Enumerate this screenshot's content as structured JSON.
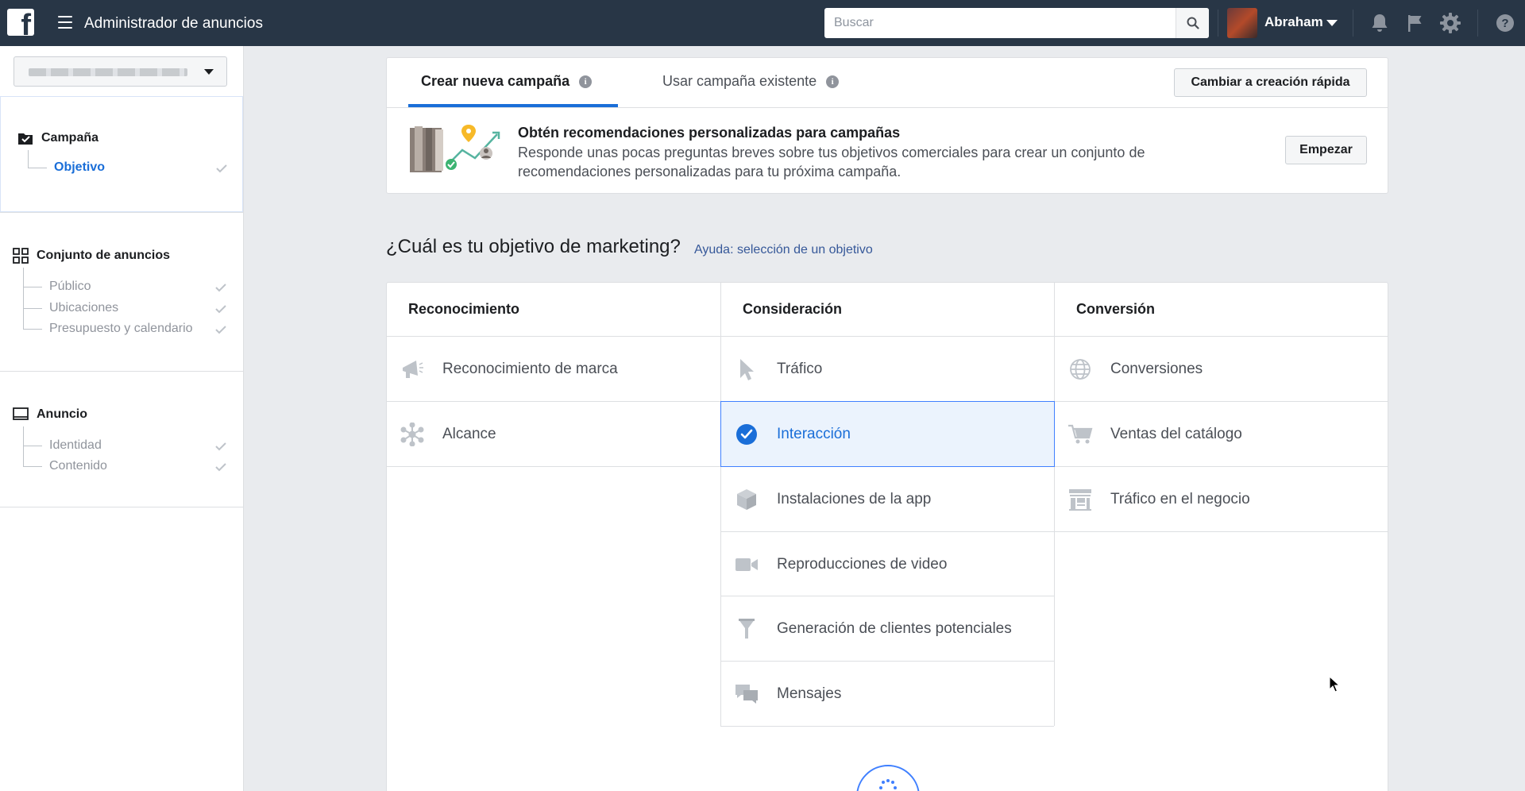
{
  "topbar": {
    "app_title": "Administrador de anuncios",
    "search_placeholder": "Buscar",
    "user_name": "Abraham"
  },
  "sidebar": {
    "sections": [
      {
        "title": "Campaña",
        "items": [
          {
            "label": "Objetivo",
            "active": true
          }
        ]
      },
      {
        "title": "Conjunto de anuncios",
        "items": [
          {
            "label": "Público"
          },
          {
            "label": "Ubicaciones"
          },
          {
            "label": "Presupuesto y calendario"
          }
        ]
      },
      {
        "title": "Anuncio",
        "items": [
          {
            "label": "Identidad"
          },
          {
            "label": "Contenido"
          }
        ]
      }
    ]
  },
  "tabs": {
    "create_new": "Crear nueva campaña",
    "use_existing": "Usar campaña existente",
    "switch_button": "Cambiar a creación rápida"
  },
  "recommendation": {
    "title": "Obtén recomendaciones personalizadas para campañas",
    "description": "Responde unas pocas preguntas breves sobre tus objetivos comerciales para crear un conjunto de recomendaciones personalizadas para tu próxima campaña.",
    "button": "Empezar"
  },
  "objectives": {
    "question": "¿Cuál es tu objetivo de marketing?",
    "help_link": "Ayuda: selección de un objetivo",
    "columns": [
      {
        "title": "Reconocimiento",
        "items": [
          "Reconocimiento de marca",
          "Alcance"
        ]
      },
      {
        "title": "Consideración",
        "items": [
          "Tráfico",
          "Interacción",
          "Instalaciones de la app",
          "Reproducciones de video",
          "Generación de clientes potenciales",
          "Mensajes"
        ]
      },
      {
        "title": "Conversión",
        "items": [
          "Conversiones",
          "Ventas del catálogo",
          "Tráfico en el negocio"
        ]
      }
    ],
    "selected": "Interacción"
  },
  "colors": {
    "topbar": "#283646",
    "accent": "#1a6ed8",
    "link": "#365899",
    "selected_bg": "#ebf3fd",
    "icon_gray": "#bec3c9"
  }
}
